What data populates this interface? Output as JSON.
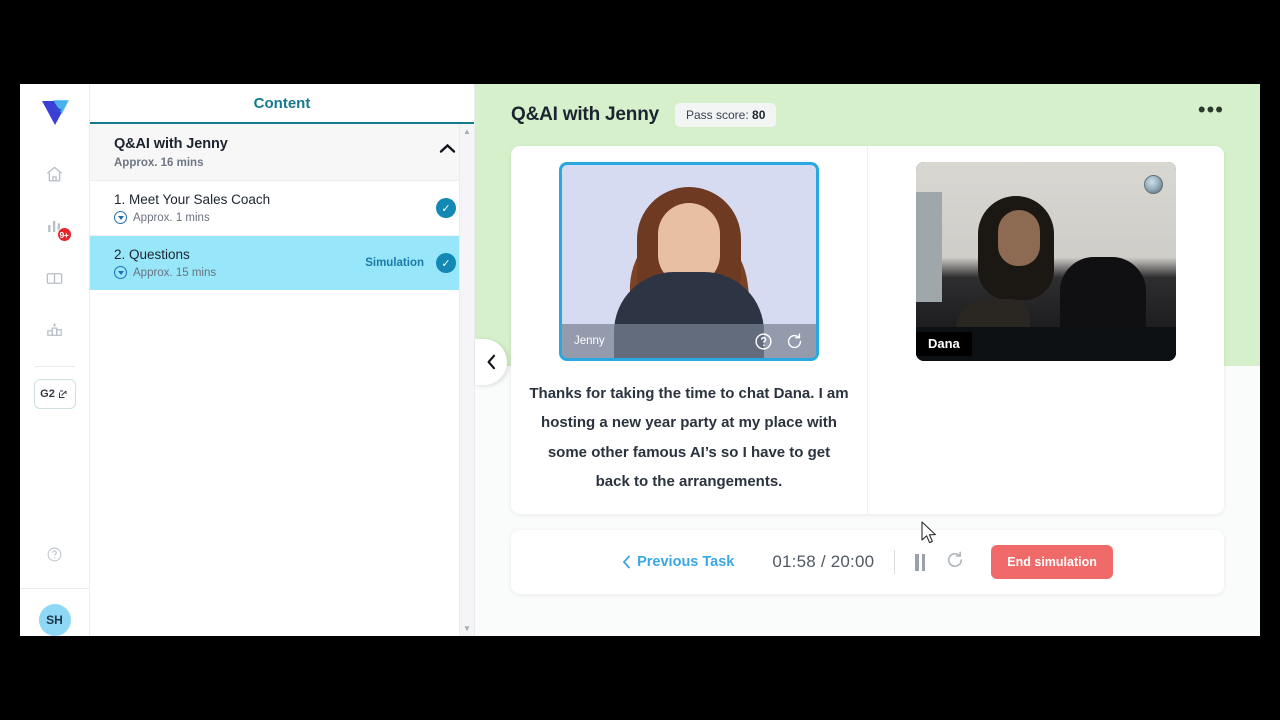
{
  "rail": {
    "logo_icon": "vidbot-v-logo",
    "items": [
      {
        "name": "home",
        "icon": "home-icon"
      },
      {
        "name": "activity",
        "icon": "activity-bars-icon",
        "badge": "9+"
      },
      {
        "name": "library",
        "icon": "book-icon"
      },
      {
        "name": "leaderboard",
        "icon": "podium-icon"
      }
    ],
    "g2_label": "G2",
    "g2_icon": "external-link-icon",
    "help_icon": "help-circle-icon",
    "avatar_initials": "SH"
  },
  "sidebar": {
    "header": "Content",
    "collapse_tab_icon": "chevron-left-icon",
    "module": {
      "title": "Q&AI with Jenny",
      "duration": "Approx. 16 mins",
      "collapse_icon": "chevron-up-icon"
    },
    "lessons": [
      {
        "title": "1. Meet Your Sales Coach",
        "duration": "Approx. 1 mins",
        "tag": "",
        "status_icon": "check-circle-icon",
        "active": false
      },
      {
        "title": "2. Questions",
        "duration": "Approx. 15 mins",
        "tag": "Simulation",
        "status_icon": "check-circle-icon",
        "active": true
      }
    ],
    "scroll_up_icon": "triangle-up-icon",
    "scroll_down_icon": "triangle-down-icon"
  },
  "main": {
    "title": "Q&AI with Jenny",
    "pass_score_label": "Pass score:",
    "pass_score_value": "80",
    "more_icon": "ellipsis-icon",
    "video_left": {
      "name": "Jenny",
      "help_icon": "question-circle-icon",
      "replay_icon": "replay-icon"
    },
    "video_right": {
      "name": "Dana",
      "indicator_icon": "camera-led-icon"
    },
    "transcript": "Thanks for taking the time to chat Dana. I am hosting a new year party at my place with some other famous AI’s so I have to get back to the arrangements."
  },
  "controls": {
    "prev_icon": "chevron-left-icon",
    "prev_label": "Previous Task",
    "time_elapsed": "01:58",
    "time_separator": "/",
    "time_total": "20:00",
    "pause_icon": "pause-icon",
    "restart_icon": "restart-icon",
    "end_label": "End simulation"
  },
  "colors": {
    "header_green": "#d5f0ca",
    "accent_teal": "#157a8c",
    "active_row": "#97e6f9",
    "check_blue": "#1388b5",
    "end_red": "#f06a6a",
    "link_blue": "#3aa7e8"
  }
}
